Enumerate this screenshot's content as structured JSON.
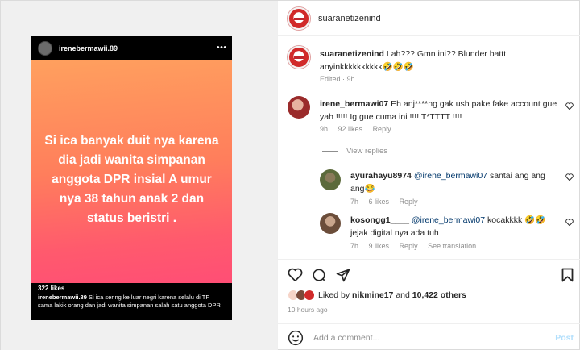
{
  "story": {
    "username": "irenebermawii.89",
    "text": "Si ica banyak duit nya karena dia jadi wanita simpanan anggota DPR insial A umur nya 38 tahun anak 2 dan status beristri .",
    "likes": "322 likes",
    "caption_user": "irenebermawii.89",
    "caption_text": "Si ica sering ke luar negri karena selalu di TF sama lakik orang dan jadi wanita simpanan salah satu anggota DPR"
  },
  "header": {
    "username": "suaranetizenind"
  },
  "comments": [
    {
      "username": "suaranetizenind",
      "text": "Lah??? Gmn ini?? Blunder battt anyinkkkkkkkkkk🤣🤣🤣",
      "meta": "Edited · 9h"
    },
    {
      "username": "irene_bermawi07",
      "text": "Eh anj****ng gak ush pake fake account gue yah !!!!! Ig gue cuma ini !!!! T*TTTT !!!!",
      "time": "9h",
      "likes": "92 likes",
      "reply": "Reply"
    }
  ],
  "view_replies": "View replies",
  "replies": [
    {
      "username": "ayurahayu8974",
      "mention": "@irene_bermawi07",
      "text": "santai ang ang ang😂",
      "time": "7h",
      "likes": "6 likes",
      "reply": "Reply"
    },
    {
      "username": "kosongg1____",
      "mention": "@irene_bermawi07",
      "text": "kocakkkk 🤣🤣 jejak digital nya ada tuh",
      "time": "7h",
      "likes": "9 likes",
      "reply": "Reply",
      "translate": "See translation"
    }
  ],
  "likes_summary": {
    "prefix": "Liked by",
    "user": "nikmine17",
    "and": "and",
    "count": "10,422 others"
  },
  "time_ago": "10 hours ago",
  "add_comment": {
    "placeholder": "Add a comment...",
    "post": "Post"
  },
  "icons": {
    "heart": "heart-icon",
    "comment": "comment-icon",
    "share": "share-icon",
    "save": "bookmark-icon",
    "emoji": "emoji-icon",
    "more": "more-icon"
  },
  "colors": {
    "mention": "#00376b",
    "meta": "#8e8e8e",
    "post_disabled": "#b2dffc"
  }
}
